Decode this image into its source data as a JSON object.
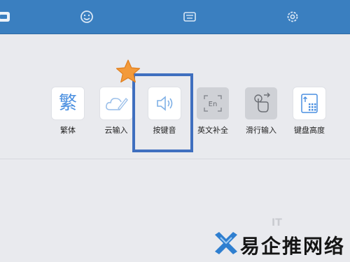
{
  "colors": {
    "topbar": "#3a7fc0",
    "accent": "#4a8fe0",
    "highlight": "#3f6fbf",
    "star": "#f39a3a"
  },
  "topbar": {
    "icons": [
      "keyboard-skin-icon",
      "emoji-icon",
      "keyboard-icon",
      "gear-icon"
    ]
  },
  "toolbar": {
    "items": [
      {
        "label": "繁体",
        "glyph": "繁",
        "icon": "traditional-chinese-icon"
      },
      {
        "label": "云输入",
        "icon": "cloud-input-icon"
      },
      {
        "label": "按键音",
        "icon": "speaker-icon"
      },
      {
        "label": "英文补全",
        "icon": "english-complete-icon",
        "icon_text": "En"
      },
      {
        "label": "滑行输入",
        "icon": "swipe-input-icon"
      },
      {
        "label": "键盘高度",
        "icon": "keyboard-height-icon"
      }
    ]
  },
  "watermark": {
    "brand": "易企推网络",
    "faint": "IT"
  }
}
